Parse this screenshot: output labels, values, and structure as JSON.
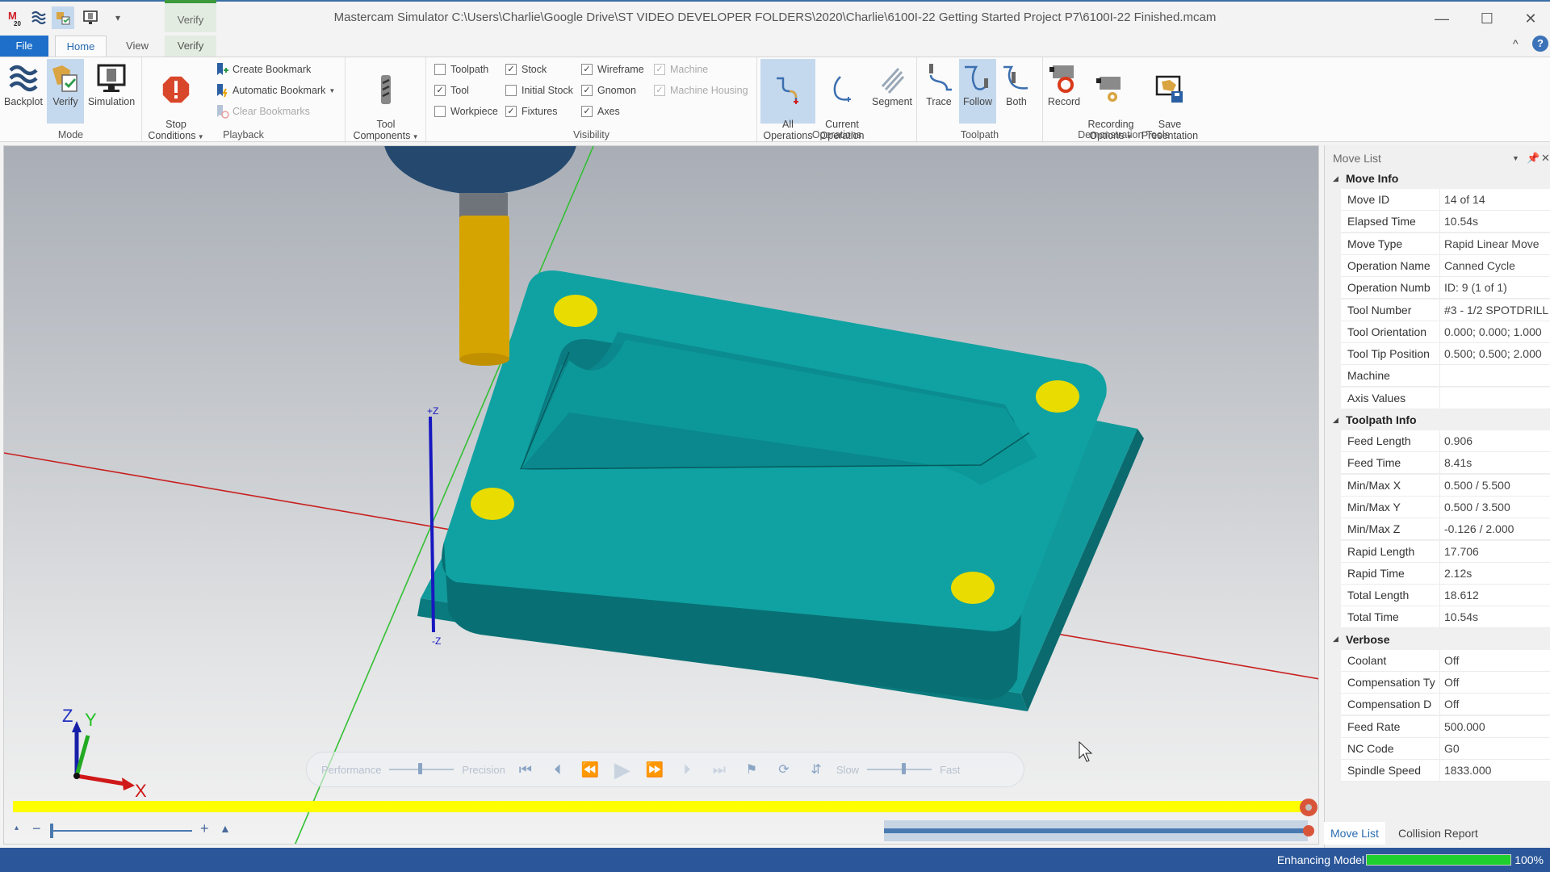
{
  "window": {
    "title": "Mastercam Simulator  C:\\Users\\Charlie\\Google Drive\\ST VIDEO DEVELOPER FOLDERS\\2020\\Charlie\\6100I-22 Getting Started Project P7\\6100I-22 Finished.mcam",
    "context_tab_group": "Verify",
    "minimize": "—",
    "maximize": "☐",
    "close": "✕"
  },
  "quick_access": {
    "icons": [
      "mastercam-logo-icon",
      "backplot-icon",
      "verify-icon",
      "simulation-icon",
      "customize-qat-icon"
    ]
  },
  "ribbon_tabs": [
    {
      "label": "File",
      "state": "file"
    },
    {
      "label": "Home",
      "state": "active"
    },
    {
      "label": "View",
      "state": "normal"
    },
    {
      "label": "Verify",
      "state": "context"
    }
  ],
  "ribbon": {
    "collapse_glyph": "^",
    "help_glyph": "?",
    "groups": {
      "mode": {
        "label": "Mode",
        "buttons": [
          {
            "label": "Backplot",
            "selected": false
          },
          {
            "label": "Verify",
            "selected": true
          },
          {
            "label": "Simulation",
            "selected": false
          }
        ]
      },
      "playback": {
        "label": "Playback",
        "stop_conditions": "Stop\nConditions",
        "create_bookmark": "Create Bookmark",
        "automatic_bookmark": "Automatic Bookmark",
        "clear_bookmarks": "Clear Bookmarks"
      },
      "tool_components": {
        "label": "Tool\nComponents"
      },
      "visibility": {
        "label": "Visibility",
        "checkboxes": [
          {
            "label": "Toolpath",
            "checked": false,
            "enabled": true
          },
          {
            "label": "Tool",
            "checked": true,
            "enabled": true
          },
          {
            "label": "Workpiece",
            "checked": false,
            "enabled": true
          },
          {
            "label": "Stock",
            "checked": true,
            "enabled": true
          },
          {
            "label": "Initial Stock",
            "checked": false,
            "enabled": true
          },
          {
            "label": "Fixtures",
            "checked": true,
            "enabled": true
          },
          {
            "label": "Wireframe",
            "checked": true,
            "enabled": true
          },
          {
            "label": "Gnomon",
            "checked": true,
            "enabled": true
          },
          {
            "label": "Axes",
            "checked": true,
            "enabled": true
          },
          {
            "label": "Machine",
            "checked": true,
            "enabled": false
          },
          {
            "label": "Machine Housing",
            "checked": true,
            "enabled": false
          }
        ]
      },
      "operations": {
        "label": "Operations",
        "buttons": [
          {
            "label": "All\nOperations",
            "selected": true
          },
          {
            "label": "Current\nOperation",
            "selected": false
          },
          {
            "label": "Segment",
            "selected": false
          }
        ]
      },
      "toolpath": {
        "label": "Toolpath",
        "buttons": [
          {
            "label": "Trace",
            "selected": false
          },
          {
            "label": "Follow",
            "selected": true
          },
          {
            "label": "Both",
            "selected": false
          }
        ]
      },
      "demo_tools": {
        "label": "Demonstration Tools",
        "buttons": [
          {
            "label": "Record"
          },
          {
            "label": "Recording\nOptions"
          },
          {
            "label": "Save\nPresentation"
          }
        ]
      }
    }
  },
  "viewport": {
    "axis_labels": {
      "plus_z": "+Z",
      "minus_z": "-Z"
    },
    "gnomon": {
      "x": "X",
      "y": "Y",
      "z": "Z"
    },
    "colors": {
      "part": "#0e9a9a",
      "spot": "#f2e600",
      "tool": "#d8a800",
      "holder": "#2a4a6a",
      "x_axis": "#d01818",
      "y_axis": "#22c022",
      "z_axis": "#1818c0"
    }
  },
  "playback_bar": {
    "performance": "Performance",
    "precision": "Precision",
    "quality_slider_fraction": 0.45,
    "slow": "Slow",
    "fast": "Fast",
    "speed_slider_fraction": 0.55
  },
  "timeline": {
    "progress_fraction": 1.0,
    "color": "#ffff00"
  },
  "zoom_control": {
    "minus": "−",
    "plus": "+"
  },
  "move_list": {
    "title": "Move List",
    "sections": [
      {
        "name": "Move Info",
        "rows": [
          {
            "key": "Move ID",
            "value": "14 of 14"
          },
          {
            "key": "Elapsed Time",
            "value": "10.54s"
          },
          {
            "key": "Move Type",
            "value": "Rapid Linear Move"
          },
          {
            "key": "Operation Name",
            "value": "Canned Cycle"
          },
          {
            "key": "Operation Numb",
            "value": "ID: 9 (1 of 1)"
          },
          {
            "key": "Tool Number",
            "value": "#3 - 1/2 SPOTDRILL"
          },
          {
            "key": "Tool Orientation",
            "value": "0.000; 0.000; 1.000"
          },
          {
            "key": "Tool Tip Position",
            "value": "0.500; 0.500; 2.000"
          },
          {
            "key": "Machine",
            "value": ""
          },
          {
            "key": "Axis Values",
            "value": ""
          }
        ]
      },
      {
        "name": "Toolpath Info",
        "rows": [
          {
            "key": "Feed Length",
            "value": "0.906"
          },
          {
            "key": "Feed Time",
            "value": "8.41s"
          },
          {
            "key": "Min/Max X",
            "value": "0.500 / 5.500"
          },
          {
            "key": "Min/Max Y",
            "value": "0.500 / 3.500"
          },
          {
            "key": "Min/Max Z",
            "value": "-0.126 / 2.000"
          },
          {
            "key": "Rapid Length",
            "value": "17.706"
          },
          {
            "key": "Rapid Time",
            "value": "2.12s"
          },
          {
            "key": "Total Length",
            "value": "18.612"
          },
          {
            "key": "Total Time",
            "value": "10.54s"
          }
        ]
      },
      {
        "name": "Verbose",
        "rows": [
          {
            "key": "Coolant",
            "value": "Off"
          },
          {
            "key": "Compensation Ty",
            "value": "Off"
          },
          {
            "key": "Compensation D",
            "value": "Off"
          },
          {
            "key": "Feed Rate",
            "value": "500.000"
          },
          {
            "key": "NC Code",
            "value": "G0"
          },
          {
            "key": "Spindle Speed",
            "value": "1833.000"
          }
        ]
      }
    ],
    "tabs": [
      {
        "label": "Move List",
        "active": true
      },
      {
        "label": "Collision Report",
        "active": false
      }
    ]
  },
  "status_bar": {
    "text": "Enhancing Model",
    "progress_percent": 100,
    "progress_label": "100%"
  }
}
